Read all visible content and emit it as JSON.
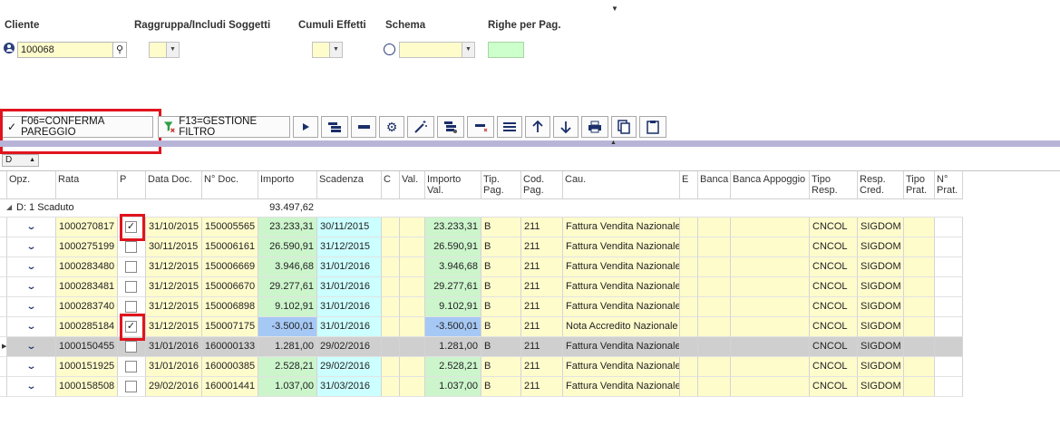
{
  "filters": {
    "cliente_label": "Cliente",
    "cliente_value": "100068",
    "raggruppa_label": "Raggruppa/Includi Soggetti",
    "cumuli_label": "Cumuli Effetti",
    "schema_label": "Schema",
    "righe_label": "Righe per Pag."
  },
  "toolbar": {
    "confirm_label": "F06=CONFERMA PAREGGIO",
    "filter_label": "F13=GESTIONE FILTRO"
  },
  "grouping": {
    "box_label": "D"
  },
  "columns": [
    "Opz.",
    "Rata",
    "P",
    "Data Doc.",
    "N° Doc.",
    "Importo",
    "Scadenza",
    "C",
    "Val.",
    "Importo Val.",
    "Tip. Pag.",
    "Cod. Pag.",
    "Cau.",
    "E",
    "Banca",
    "Banca Appoggio",
    "Tipo Resp.",
    "Resp. Cred.",
    "Tipo Prat.",
    "N° Prat."
  ],
  "group": {
    "label": "D: 1 Scaduto",
    "total": "93.497,62"
  },
  "rows": [
    {
      "rata": "1000270817",
      "p": "✓",
      "data": "31/10/2015",
      "ndoc": "150005565",
      "importo": "23.233,31",
      "scad": "30/11/2015",
      "impval": "23.233,31",
      "tip": "B",
      "cod": "211",
      "cau": "Fattura Vendita Nazionale",
      "tresp": "CNCOL",
      "rcred": "SIGDOM"
    },
    {
      "rata": "1000275199",
      "p": "",
      "data": "30/11/2015",
      "ndoc": "150006161",
      "importo": "26.590,91",
      "scad": "31/12/2015",
      "impval": "26.590,91",
      "tip": "B",
      "cod": "211",
      "cau": "Fattura Vendita Nazionale",
      "tresp": "CNCOL",
      "rcred": "SIGDOM"
    },
    {
      "rata": "1000283480",
      "p": "",
      "data": "31/12/2015",
      "ndoc": "150006669",
      "importo": "3.946,68",
      "scad": "31/01/2016",
      "impval": "3.946,68",
      "tip": "B",
      "cod": "211",
      "cau": "Fattura Vendita Nazionale",
      "tresp": "CNCOL",
      "rcred": "SIGDOM"
    },
    {
      "rata": "1000283481",
      "p": "",
      "data": "31/12/2015",
      "ndoc": "150006670",
      "importo": "29.277,61",
      "scad": "31/01/2016",
      "impval": "29.277,61",
      "tip": "B",
      "cod": "211",
      "cau": "Fattura Vendita Nazionale",
      "tresp": "CNCOL",
      "rcred": "SIGDOM"
    },
    {
      "rata": "1000283740",
      "p": "",
      "data": "31/12/2015",
      "ndoc": "150006898",
      "importo": "9.102,91",
      "scad": "31/01/2016",
      "impval": "9.102,91",
      "tip": "B",
      "cod": "211",
      "cau": "Fattura Vendita Nazionale",
      "tresp": "CNCOL",
      "rcred": "SIGDOM"
    },
    {
      "rata": "1000285184",
      "p": "✓",
      "data": "31/12/2015",
      "ndoc": "150007175",
      "importo": "-3.500,01",
      "scad": "31/01/2016",
      "impval": "-3.500,01",
      "tip": "B",
      "cod": "211",
      "cau": "Nota Accredito Nazionale",
      "tresp": "CNCOL",
      "rcred": "SIGDOM"
    },
    {
      "rata": "1000150455",
      "p": "",
      "data": "31/01/2016",
      "ndoc": "160000133",
      "importo": "1.281,00",
      "scad": "29/02/2016",
      "impval": "1.281,00",
      "tip": "B",
      "cod": "211",
      "cau": "Fattura Vendita Nazionale",
      "tresp": "CNCOL",
      "rcred": "SIGDOM"
    },
    {
      "rata": "1000151925",
      "p": "",
      "data": "31/01/2016",
      "ndoc": "160000385",
      "importo": "2.528,21",
      "scad": "29/02/2016",
      "impval": "2.528,21",
      "tip": "B",
      "cod": "211",
      "cau": "Fattura Vendita Nazionale",
      "tresp": "CNCOL",
      "rcred": "SIGDOM"
    },
    {
      "rata": "1000158508",
      "p": "",
      "data": "29/02/2016",
      "ndoc": "160001441",
      "importo": "1.037,00",
      "scad": "31/03/2016",
      "impval": "1.037,00",
      "tip": "B",
      "cod": "211",
      "cau": "Fattura Vendita Nazionale",
      "tresp": "CNCOL",
      "rcred": "SIGDOM"
    }
  ],
  "colors": {
    "yellow_cell": "#fffccc",
    "green_cell": "#ccf5cc",
    "cyan_cell": "#ccffff",
    "negative_cell": "#a6c8f5",
    "selected_row": "#cfcfcf",
    "highlight_red": "#e0141e"
  }
}
